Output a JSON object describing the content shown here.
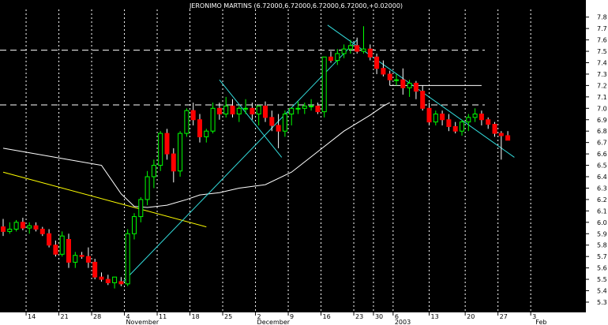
{
  "chart_data": {
    "type": "candlestick",
    "title": "JERONIMO MARTINS (6.72000,6.72000,6.72000,6.72000,+0.02000)",
    "ylim": [
      5.21,
      7.95
    ],
    "y_ticks": [
      "5.3",
      "5.4",
      "5.5",
      "5.6",
      "5.7",
      "5.8",
      "5.9",
      "6.0",
      "6.1",
      "6.2",
      "6.3",
      "6.4",
      "6.5",
      "6.6",
      "6.7",
      "6.8",
      "6.9",
      "7.0",
      "7.1",
      "7.2",
      "7.3",
      "7.4",
      "7.5",
      "7.6",
      "7.7",
      "7.8"
    ],
    "x_ticks": [
      "14",
      "21",
      "28",
      "4",
      "11",
      "18",
      "25",
      "2",
      "9",
      "16",
      "23",
      "30",
      "6",
      "13",
      "20",
      "27",
      "3"
    ],
    "x_tick_index": [
      3.5,
      8.5,
      13.5,
      18.5,
      23.5,
      28.5,
      33.5,
      38.5,
      43.5,
      48.5,
      53.5,
      56.5,
      59.5,
      65.0,
      70.5,
      75.5,
      80.5
    ],
    "month_labels": [
      "November",
      "December",
      "2003",
      "Feb"
    ],
    "month_label_index": [
      18.5,
      38.5,
      59.5,
      81.0
    ],
    "colors": {
      "background": "#000000",
      "up_candle": "#00ff00",
      "down_candle": "#ff0000",
      "moving_average": "#ffffff",
      "trend_line": "#33dddd",
      "support_line": "#ffff00",
      "axis_panel": "#ffffff",
      "grid": "#ffffff"
    },
    "grid": true,
    "ohlc": [
      [
        5.96,
        6.03,
        5.88,
        5.92
      ],
      [
        5.92,
        6.0,
        5.9,
        5.94
      ],
      [
        5.94,
        6.02,
        5.92,
        6.0
      ],
      [
        6.0,
        6.04,
        5.93,
        5.95
      ],
      [
        5.95,
        6.0,
        5.9,
        5.97
      ],
      [
        5.97,
        6.0,
        5.92,
        5.94
      ],
      [
        5.94,
        5.96,
        5.88,
        5.9
      ],
      [
        5.9,
        5.94,
        5.78,
        5.8
      ],
      [
        5.8,
        5.84,
        5.7,
        5.72
      ],
      [
        5.72,
        5.92,
        5.7,
        5.88
      ],
      [
        5.85,
        5.9,
        5.6,
        5.65
      ],
      [
        5.65,
        5.74,
        5.6,
        5.71
      ],
      [
        5.71,
        5.74,
        5.68,
        5.7
      ],
      [
        5.7,
        5.78,
        5.6,
        5.65
      ],
      [
        5.65,
        5.68,
        5.5,
        5.52
      ],
      [
        5.52,
        5.56,
        5.48,
        5.5
      ],
      [
        5.5,
        5.54,
        5.45,
        5.47
      ],
      [
        5.47,
        5.52,
        5.42,
        5.52
      ],
      [
        5.48,
        5.52,
        5.44,
        5.46
      ],
      [
        5.46,
        5.94,
        5.44,
        5.9
      ],
      [
        5.9,
        6.08,
        5.85,
        6.05
      ],
      [
        6.05,
        6.22,
        6.0,
        6.2
      ],
      [
        6.2,
        6.45,
        6.15,
        6.4
      ],
      [
        6.4,
        6.55,
        6.3,
        6.5
      ],
      [
        6.5,
        6.8,
        6.45,
        6.78
      ],
      [
        6.78,
        6.82,
        6.55,
        6.6
      ],
      [
        6.6,
        6.65,
        6.35,
        6.45
      ],
      [
        6.45,
        6.8,
        6.4,
        6.78
      ],
      [
        6.78,
        7.0,
        6.75,
        6.98
      ],
      [
        6.98,
        7.05,
        6.85,
        6.9
      ],
      [
        6.9,
        6.95,
        6.7,
        6.75
      ],
      [
        6.75,
        6.82,
        6.7,
        6.8
      ],
      [
        6.8,
        7.05,
        6.78,
        7.0
      ],
      [
        7.0,
        7.05,
        6.9,
        6.95
      ],
      [
        6.95,
        7.1,
        6.92,
        7.02
      ],
      [
        7.02,
        7.08,
        6.92,
        6.95
      ],
      [
        6.95,
        7.02,
        6.88,
        7.0
      ],
      [
        7.0,
        7.08,
        6.95,
        7.0
      ],
      [
        7.0,
        7.05,
        6.9,
        6.95
      ],
      [
        6.95,
        7.02,
        6.85,
        7.02
      ],
      [
        7.02,
        7.06,
        6.88,
        6.92
      ],
      [
        6.92,
        6.98,
        6.8,
        6.85
      ],
      [
        6.85,
        6.95,
        6.65,
        6.8
      ],
      [
        6.8,
        6.98,
        6.75,
        6.95
      ],
      [
        6.95,
        7.0,
        6.85,
        7.0
      ],
      [
        7.0,
        7.06,
        6.95,
        7.0
      ],
      [
        7.0,
        7.05,
        6.95,
        7.02
      ],
      [
        7.02,
        7.08,
        6.98,
        7.02
      ],
      [
        7.02,
        7.05,
        6.95,
        6.97
      ],
      [
        6.97,
        7.45,
        6.92,
        7.45
      ],
      [
        7.45,
        7.5,
        7.4,
        7.42
      ],
      [
        7.42,
        7.52,
        7.38,
        7.48
      ],
      [
        7.48,
        7.56,
        7.44,
        7.52
      ],
      [
        7.52,
        7.6,
        7.48,
        7.55
      ],
      [
        7.55,
        7.62,
        7.48,
        7.5
      ],
      [
        7.5,
        7.72,
        7.48,
        7.52
      ],
      [
        7.52,
        7.56,
        7.42,
        7.45
      ],
      [
        7.45,
        7.48,
        7.3,
        7.35
      ],
      [
        7.35,
        7.42,
        7.28,
        7.3
      ],
      [
        7.3,
        7.33,
        7.2,
        7.25
      ],
      [
        7.25,
        7.3,
        7.2,
        7.25
      ],
      [
        7.25,
        7.35,
        7.12,
        7.18
      ],
      [
        7.18,
        7.25,
        7.1,
        7.22
      ],
      [
        7.22,
        7.24,
        7.08,
        7.15
      ],
      [
        7.15,
        7.2,
        6.98,
        7.0
      ],
      [
        7.0,
        7.05,
        6.85,
        6.88
      ],
      [
        6.88,
        6.98,
        6.85,
        6.95
      ],
      [
        6.95,
        6.98,
        6.85,
        6.9
      ],
      [
        6.9,
        6.95,
        6.8,
        6.84
      ],
      [
        6.84,
        6.88,
        6.78,
        6.8
      ],
      [
        6.8,
        6.9,
        6.76,
        6.88
      ],
      [
        6.88,
        6.95,
        6.8,
        6.92
      ],
      [
        6.92,
        7.0,
        6.88,
        6.95
      ],
      [
        6.95,
        6.98,
        6.85,
        6.9
      ],
      [
        6.9,
        6.92,
        6.82,
        6.86
      ],
      [
        6.86,
        6.88,
        6.75,
        6.78
      ],
      [
        6.78,
        6.8,
        6.55,
        6.76
      ],
      [
        6.76,
        6.8,
        6.72,
        6.72
      ]
    ],
    "moving_average": [
      [
        0,
        6.65
      ],
      [
        5,
        6.6
      ],
      [
        10,
        6.55
      ],
      [
        15,
        6.5
      ],
      [
        18,
        6.25
      ],
      [
        20,
        6.14
      ],
      [
        22,
        6.13
      ],
      [
        25,
        6.15
      ],
      [
        28,
        6.2
      ],
      [
        30,
        6.24
      ],
      [
        33,
        6.26
      ],
      [
        36,
        6.3
      ],
      [
        40,
        6.33
      ],
      [
        44,
        6.44
      ],
      [
        48,
        6.62
      ],
      [
        52,
        6.8
      ],
      [
        56,
        6.94
      ],
      [
        58,
        7.02
      ],
      [
        59,
        7.05
      ]
    ],
    "resistance_levels": [
      7.51,
      7.03
    ],
    "resistance_line_extent": [
      0,
      73.5
    ],
    "level_7_20_segment": {
      "x": [
        59.0,
        73.0
      ],
      "y": 7.2
    },
    "support_line": {
      "x": [
        0,
        31.0
      ],
      "y": [
        6.44,
        5.96
      ]
    },
    "uptrend_line": {
      "x": [
        18.0,
        54.0
      ],
      "y": [
        5.46,
        7.6
      ]
    },
    "downtrend_line": {
      "x": [
        49.5,
        78.0
      ],
      "y": [
        7.73,
        6.57
      ]
    },
    "short_trend_line": {
      "x": [
        33.0,
        42.5
      ],
      "y": [
        7.25,
        6.57
      ]
    }
  }
}
